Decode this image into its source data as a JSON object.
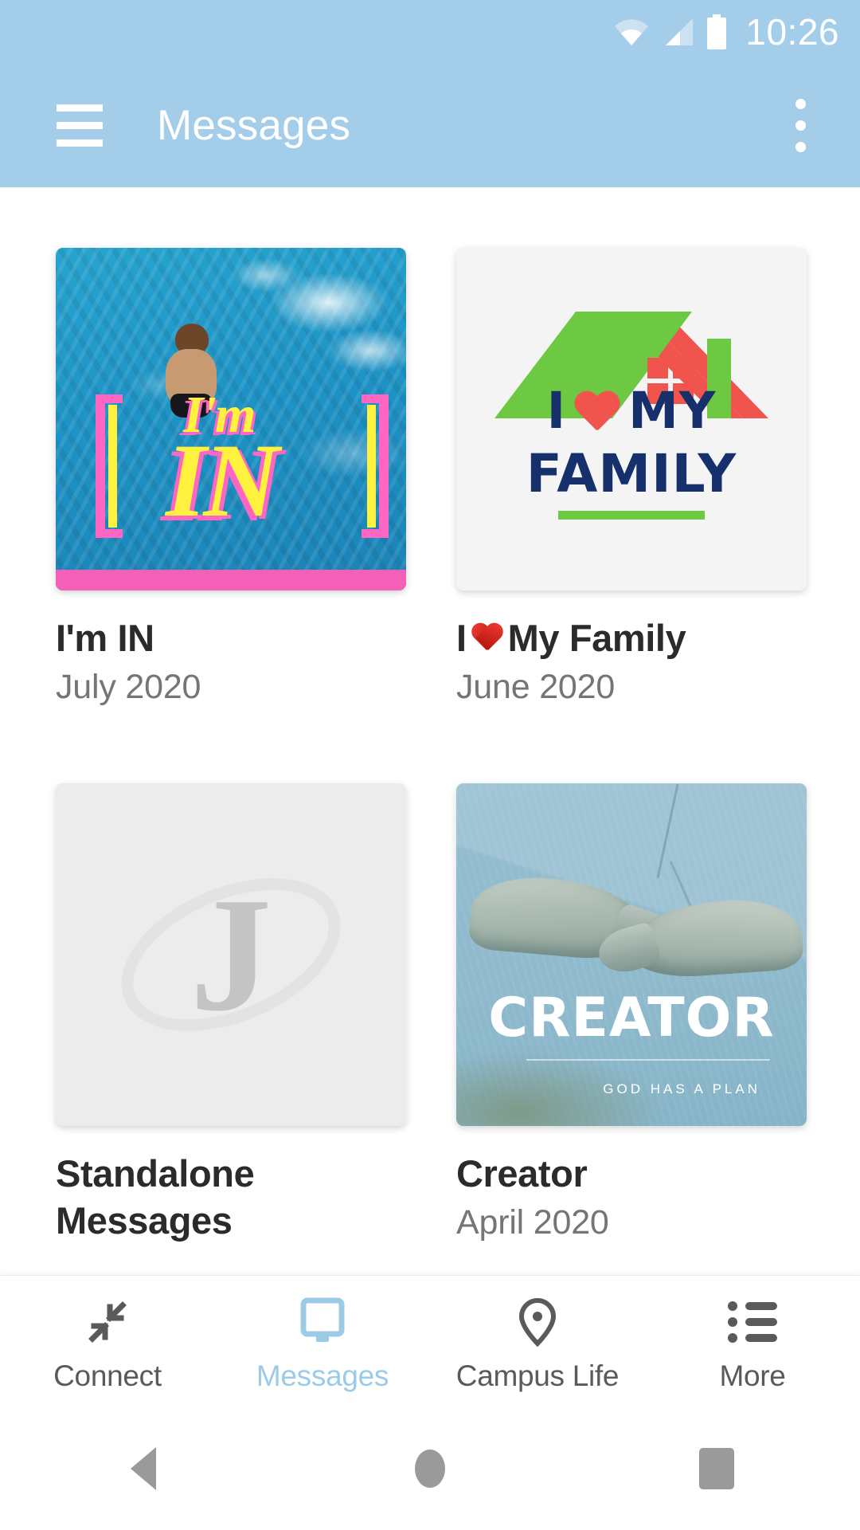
{
  "status_bar": {
    "time": "10:26",
    "wifi_icon": "wifi-icon",
    "signal_icon": "cell-signal-icon",
    "battery_icon": "battery-icon"
  },
  "app_bar": {
    "menu_icon": "hamburger-menu-icon",
    "title": "Messages",
    "overflow_icon": "more-vertical-icon"
  },
  "cards": [
    {
      "title": "I'm IN",
      "date": "July 2020",
      "artwork": {
        "kind": "photo",
        "overlay_top": "I'm",
        "overlay_main": "IN",
        "accent_yellow": "#fff23f",
        "accent_pink": "#ff66c4",
        "bar_color": "#f45fb8"
      }
    },
    {
      "title_prefix": "I",
      "title_heart": "heart-emoji",
      "title_suffix": "My Family",
      "date": "June 2020",
      "artwork": {
        "kind": "logo",
        "line1": "I",
        "line1_suffix": "MY",
        "line2": "FAMILY",
        "roof_color": "#6dc942",
        "accent_red": "#f1544d",
        "text_navy": "#15306b",
        "background": "#f4f4f4"
      }
    },
    {
      "title": "Standalone Messages",
      "date": "",
      "artwork": {
        "kind": "placeholder",
        "letter": "J",
        "background": "#ececec"
      }
    },
    {
      "title": "Creator",
      "date": "April 2020",
      "artwork": {
        "kind": "photo",
        "overlay_main": "CREATOR",
        "overlay_sub": "GOD HAS A PLAN"
      }
    }
  ],
  "bottom_nav": {
    "items": [
      {
        "label": "Connect",
        "icon": "connect-arrows-icon",
        "active": false
      },
      {
        "label": "Messages",
        "icon": "screen-icon",
        "active": true
      },
      {
        "label": "Campus Life",
        "icon": "location-pin-icon",
        "active": false
      },
      {
        "label": "More",
        "icon": "list-icon",
        "active": false
      }
    ],
    "active_color": "#9ccbe8",
    "inactive_color": "#5a5a5a"
  },
  "system_nav": {
    "back": "back-triangle-icon",
    "home": "home-circle-icon",
    "recents": "recents-square-icon"
  },
  "theme": {
    "header_blue": "#a4cde9",
    "page_background": "#ffffff"
  }
}
